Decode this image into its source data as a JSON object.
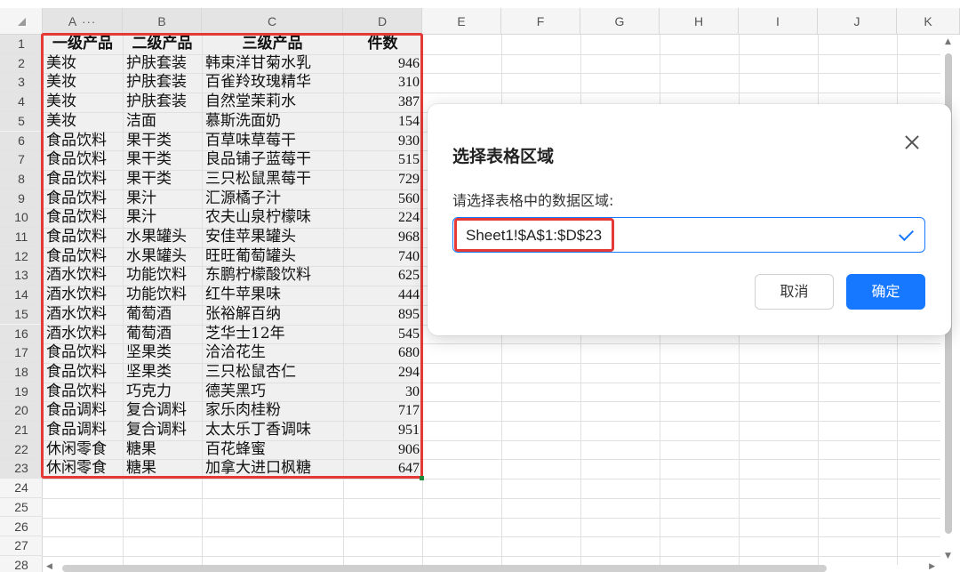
{
  "columns": [
    "A",
    "B",
    "C",
    "D",
    "E",
    "F",
    "G",
    "H",
    "I",
    "J",
    "K"
  ],
  "column_menu_glyph": "···",
  "rows": [
    "1",
    "2",
    "3",
    "4",
    "5",
    "6",
    "7",
    "8",
    "9",
    "10",
    "11",
    "12",
    "13",
    "14",
    "15",
    "16",
    "17",
    "18",
    "19",
    "20",
    "21",
    "22",
    "23",
    "24",
    "25",
    "26",
    "27",
    "28"
  ],
  "table": {
    "headers": [
      "一级产品",
      "二级产品",
      "三级产品",
      "件数"
    ],
    "rows": [
      [
        "美妆",
        "护肤套装",
        "韩束洋甘菊水乳",
        "946"
      ],
      [
        "美妆",
        "护肤套装",
        "百雀羚玫瑰精华",
        "310"
      ],
      [
        "美妆",
        "护肤套装",
        "自然堂茉莉水",
        "387"
      ],
      [
        "美妆",
        "洁面",
        "慕斯洗面奶",
        "154"
      ],
      [
        "食品饮料",
        "果干类",
        "百草味草莓干",
        "930"
      ],
      [
        "食品饮料",
        "果干类",
        "良品铺子蓝莓干",
        "515"
      ],
      [
        "食品饮料",
        "果干类",
        "三只松鼠黑莓干",
        "729"
      ],
      [
        "食品饮料",
        "果汁",
        "汇源橘子汁",
        "560"
      ],
      [
        "食品饮料",
        "果汁",
        "农夫山泉柠檬味",
        "224"
      ],
      [
        "食品饮料",
        "水果罐头",
        "安佳苹果罐头",
        "968"
      ],
      [
        "食品饮料",
        "水果罐头",
        "旺旺葡萄罐头",
        "740"
      ],
      [
        "酒水饮料",
        "功能饮料",
        "东鹏柠檬酸饮料",
        "625"
      ],
      [
        "酒水饮料",
        "功能饮料",
        "红牛苹果味",
        "444"
      ],
      [
        "酒水饮料",
        "葡萄酒",
        "张裕解百纳",
        "895"
      ],
      [
        "酒水饮料",
        "葡萄酒",
        "芝华士12年",
        "545"
      ],
      [
        "食品饮料",
        "坚果类",
        "洽洽花生",
        "680"
      ],
      [
        "食品饮料",
        "坚果类",
        "三只松鼠杏仁",
        "294"
      ],
      [
        "食品饮料",
        "巧克力",
        "德芙黑巧",
        "30"
      ],
      [
        "食品调料",
        "复合调料",
        "家乐肉桂粉",
        "717"
      ],
      [
        "食品调料",
        "复合调料",
        "太太乐丁香调味",
        "951"
      ],
      [
        "休闲零食",
        "糖果",
        "百花蜂蜜",
        "906"
      ],
      [
        "休闲零食",
        "糖果",
        "加拿大进口枫糖",
        "647"
      ]
    ]
  },
  "dialog": {
    "title": "选择表格区域",
    "label": "请选择表格中的数据区域:",
    "range_value": "Sheet1!$A$1:$D$23",
    "cancel_label": "取消",
    "ok_label": "确定"
  },
  "colors": {
    "highlight_red": "#e53935",
    "primary_blue": "#1677ff",
    "selection_gray": "#f0f0f0"
  }
}
